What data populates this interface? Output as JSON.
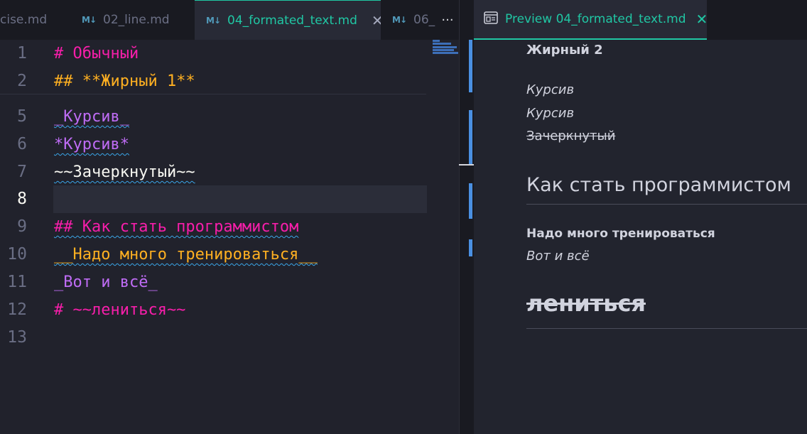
{
  "tabs": [
    {
      "label": "cise.md",
      "icon": "",
      "active": false
    },
    {
      "label": "02_line.md",
      "icon": "markdown-icon",
      "active": false
    },
    {
      "label": "04_formated_text.md",
      "icon": "markdown-icon",
      "active": true
    },
    {
      "label": "06_",
      "icon": "markdown-icon",
      "active": false
    }
  ],
  "tab_close_glyph": "✕",
  "more_actions": "···",
  "preview_tab": {
    "label": "Preview 04_formated_text.md",
    "close_glyph": "✕"
  },
  "editor": {
    "current_line": 8,
    "lines": [
      {
        "num": "1",
        "text": "# Обычный"
      },
      {
        "num": "2",
        "text": "## **Жирный 1**"
      },
      {
        "num": "5",
        "text": "_Курсив_"
      },
      {
        "num": "6",
        "text": "*Курсив*"
      },
      {
        "num": "7",
        "text": "~~Зачеркнутый~~"
      },
      {
        "num": "8",
        "text": ""
      },
      {
        "num": "9",
        "text": "## Как стать программистом"
      },
      {
        "num": "10",
        "text": "__Надо много тренироваться__"
      },
      {
        "num": "11",
        "text": "_Вот и всё_"
      },
      {
        "num": "12",
        "text": "# ~~лениться~~"
      },
      {
        "num": "13",
        "text": ""
      }
    ]
  },
  "preview": {
    "bold_heading": "Жирный 2",
    "italic_1": "Курсив",
    "italic_2": "Курсив",
    "strikethrough": "Зачеркнутый",
    "h2": "Как стать программистом",
    "bold_text": "Надо много тренироваться",
    "italic_3": "Вот и всё",
    "h1_strike": "лениться"
  },
  "colors": {
    "accent": "#20c7a4",
    "heading": "#f71eaa",
    "bold": "#ffb021",
    "italic": "#bf6cf5",
    "text": "#f8f8f2",
    "background": "#21222c"
  }
}
